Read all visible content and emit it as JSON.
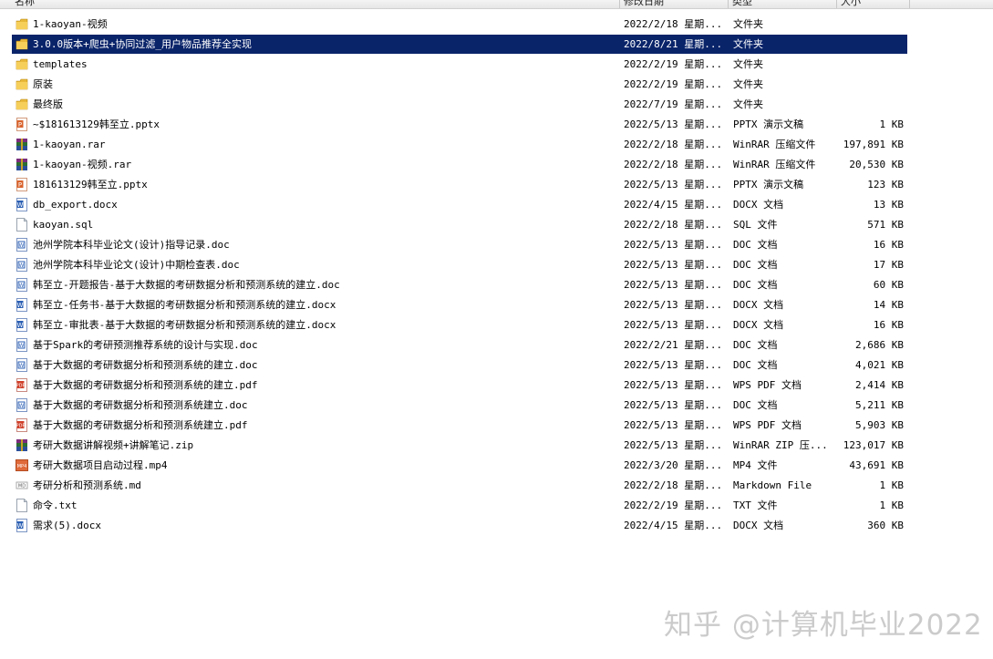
{
  "columns": {
    "name": "名称",
    "date": "修改日期",
    "type": "类型",
    "size": "大小"
  },
  "files": [
    {
      "name": "1-kaoyan-视频",
      "date": "2022/2/18 星期...",
      "type": "文件夹",
      "size": "",
      "icon": "folder-icon"
    },
    {
      "name": "3.0.0版本+爬虫+协同过滤_用户物品推荐全实现",
      "date": "2022/8/21 星期...",
      "type": "文件夹",
      "size": "",
      "icon": "folder-icon",
      "selected": true
    },
    {
      "name": "templates",
      "date": "2022/2/19 星期...",
      "type": "文件夹",
      "size": "",
      "icon": "folder-icon"
    },
    {
      "name": "原装",
      "date": "2022/2/19 星期...",
      "type": "文件夹",
      "size": "",
      "icon": "folder-icon"
    },
    {
      "name": "最终版",
      "date": "2022/7/19 星期...",
      "type": "文件夹",
      "size": "",
      "icon": "folder-icon"
    },
    {
      "name": "~$181613129韩至立.pptx",
      "date": "2022/5/13 星期...",
      "type": "PPTX 演示文稿",
      "size": "1 KB",
      "icon": "pptx-icon"
    },
    {
      "name": "1-kaoyan.rar",
      "date": "2022/2/18 星期...",
      "type": "WinRAR 压缩文件",
      "size": "197,891 KB",
      "icon": "rar-icon"
    },
    {
      "name": "1-kaoyan-视频.rar",
      "date": "2022/2/18 星期...",
      "type": "WinRAR 压缩文件",
      "size": "20,530 KB",
      "icon": "rar-icon"
    },
    {
      "name": "181613129韩至立.pptx",
      "date": "2022/5/13 星期...",
      "type": "PPTX 演示文稿",
      "size": "123 KB",
      "icon": "pptx-icon"
    },
    {
      "name": "db_export.docx",
      "date": "2022/4/15 星期...",
      "type": "DOCX 文档",
      "size": "13 KB",
      "icon": "word-icon"
    },
    {
      "name": "kaoyan.sql",
      "date": "2022/2/18 星期...",
      "type": "SQL 文件",
      "size": "571 KB",
      "icon": "blank-file-icon"
    },
    {
      "name": "池州学院本科毕业论文(设计)指导记录.doc",
      "date": "2022/5/13 星期...",
      "type": "DOC 文档",
      "size": "16 KB",
      "icon": "doc-icon"
    },
    {
      "name": "池州学院本科毕业论文(设计)中期检查表.doc",
      "date": "2022/5/13 星期...",
      "type": "DOC 文档",
      "size": "17 KB",
      "icon": "doc-icon"
    },
    {
      "name": "韩至立-开题报告-基于大数据的考研数据分析和预测系统的建立.doc",
      "date": "2022/5/13 星期...",
      "type": "DOC 文档",
      "size": "60 KB",
      "icon": "doc-icon"
    },
    {
      "name": "韩至立-任务书-基于大数据的考研数据分析和预测系统的建立.docx",
      "date": "2022/5/13 星期...",
      "type": "DOCX 文档",
      "size": "14 KB",
      "icon": "word-icon"
    },
    {
      "name": "韩至立-审批表-基于大数据的考研数据分析和预测系统的建立.docx",
      "date": "2022/5/13 星期...",
      "type": "DOCX 文档",
      "size": "16 KB",
      "icon": "word-icon"
    },
    {
      "name": "基于Spark的考研预测推荐系统的设计与实现.doc",
      "date": "2022/2/21 星期...",
      "type": "DOC 文档",
      "size": "2,686 KB",
      "icon": "doc-icon"
    },
    {
      "name": "基于大数据的考研数据分析和预测系统的建立.doc",
      "date": "2022/5/13 星期...",
      "type": "DOC 文档",
      "size": "4,021 KB",
      "icon": "doc-icon"
    },
    {
      "name": "基于大数据的考研数据分析和预测系统的建立.pdf",
      "date": "2022/5/13 星期...",
      "type": "WPS PDF 文档",
      "size": "2,414 KB",
      "icon": "pdf-icon"
    },
    {
      "name": "基于大数据的考研数据分析和预测系统建立.doc",
      "date": "2022/5/13 星期...",
      "type": "DOC 文档",
      "size": "5,211 KB",
      "icon": "doc-icon"
    },
    {
      "name": "基于大数据的考研数据分析和预测系统建立.pdf",
      "date": "2022/5/13 星期...",
      "type": "WPS PDF 文档",
      "size": "5,903 KB",
      "icon": "pdf-icon"
    },
    {
      "name": "考研大数据讲解视频+讲解笔记.zip",
      "date": "2022/5/13 星期...",
      "type": "WinRAR ZIP 压...",
      "size": "123,017 KB",
      "icon": "rar-icon"
    },
    {
      "name": "考研大数据项目启动过程.mp4",
      "date": "2022/3/20 星期...",
      "type": "MP4 文件",
      "size": "43,691 KB",
      "icon": "mp4-icon"
    },
    {
      "name": "考研分析和预测系统.md",
      "date": "2022/2/18 星期...",
      "type": "Markdown File",
      "size": "1 KB",
      "icon": "md-icon"
    },
    {
      "name": "命令.txt",
      "date": "2022/2/19 星期...",
      "type": "TXT 文件",
      "size": "1 KB",
      "icon": "blank-file-icon"
    },
    {
      "name": "需求(5).docx",
      "date": "2022/4/15 星期...",
      "type": "DOCX 文档",
      "size": "360 KB",
      "icon": "word-icon"
    }
  ],
  "watermark": "知乎 @计算机毕业2022",
  "colors": {
    "selection": "#0a246a",
    "folder": "#e8b93a",
    "word": "#2b5fb4",
    "pdf": "#d0402a",
    "pptx": "#d9622b"
  }
}
